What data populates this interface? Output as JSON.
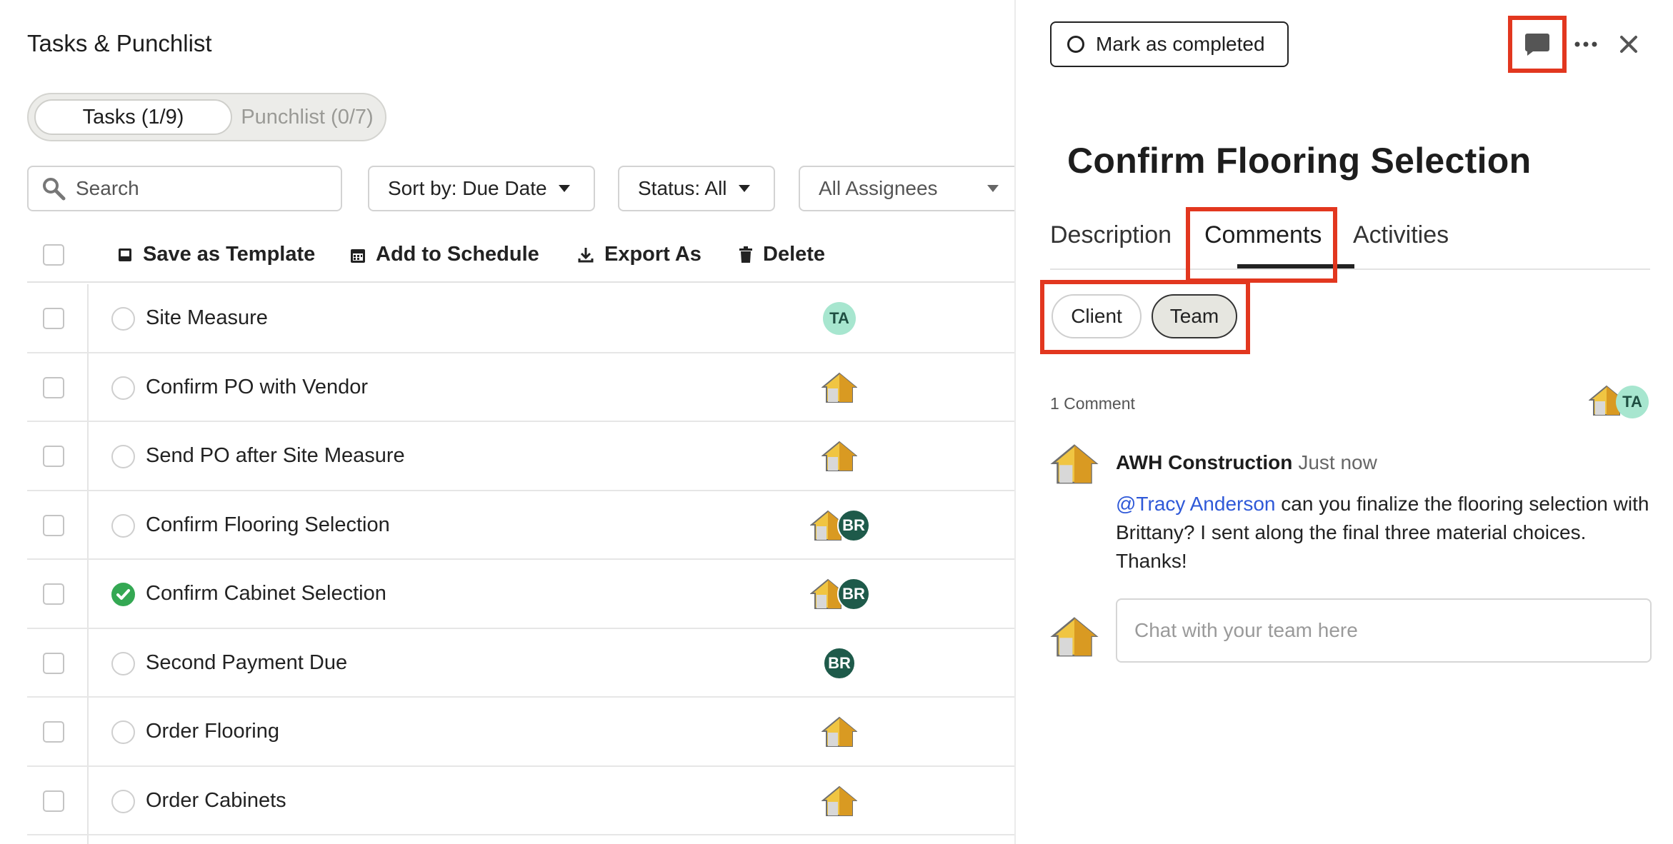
{
  "page": {
    "title": "Tasks & Punchlist"
  },
  "segment": {
    "tasks_label": "Tasks (1/9)",
    "punchlist_label": "Punchlist (0/7)"
  },
  "filters": {
    "search_placeholder": "Search",
    "sort_label": "Sort by: Due Date",
    "status_label": "Status: All",
    "assignees_label": "All Assignees"
  },
  "toolbar": {
    "save_template": "Save as Template",
    "add_schedule": "Add to Schedule",
    "export": "Export As",
    "delete": "Delete"
  },
  "tasks": [
    {
      "label": "Site Measure",
      "done": false,
      "assignees": [
        "TA"
      ]
    },
    {
      "label": "Confirm PO with Vendor",
      "done": false,
      "assignees": [
        "house"
      ]
    },
    {
      "label": "Send PO after Site Measure",
      "done": false,
      "assignees": [
        "house"
      ]
    },
    {
      "label": "Confirm Flooring Selection",
      "done": false,
      "assignees": [
        "house",
        "BR"
      ]
    },
    {
      "label": "Confirm Cabinet Selection",
      "done": true,
      "assignees": [
        "house",
        "BR"
      ]
    },
    {
      "label": "Second Payment Due",
      "done": false,
      "assignees": [
        "BR"
      ]
    },
    {
      "label": "Order Flooring",
      "done": false,
      "assignees": [
        "house"
      ]
    },
    {
      "label": "Order Cabinets",
      "done": false,
      "assignees": [
        "house"
      ]
    }
  ],
  "detail": {
    "mark_completed": "Mark as completed",
    "title": "Confirm Flooring Selection",
    "tabs": {
      "description": "Description",
      "comments": "Comments",
      "activities": "Activities"
    },
    "audience": {
      "client": "Client",
      "team": "Team"
    },
    "comment_count": "1 Comment",
    "watcher_initials": "TA",
    "comment": {
      "author": "AWH Construction",
      "time": "Just now",
      "mention": "@Tracy Anderson",
      "text": " can you finalize the flooring selection with Brittany? I sent along the final three material choices. Thanks!"
    },
    "chat_placeholder": "Chat with your team here"
  },
  "colors": {
    "highlight": "#e2371f",
    "mention": "#2f59d8",
    "done": "#34a853",
    "avatar_ta": "#a7e6cf",
    "avatar_br": "#1e5a4a"
  }
}
